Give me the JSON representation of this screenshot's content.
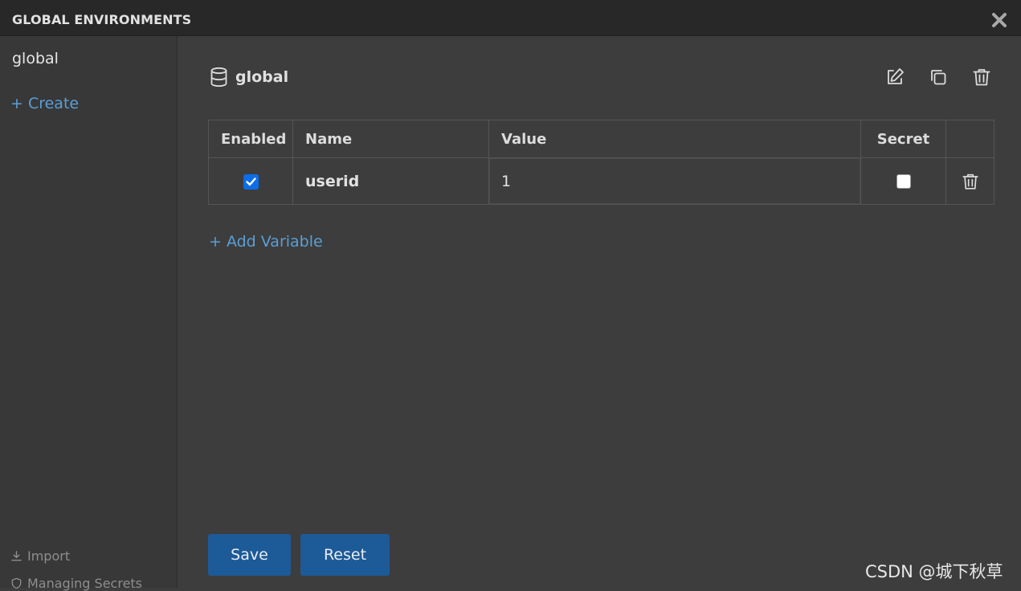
{
  "window": {
    "title": "GLOBAL ENVIRONMENTS"
  },
  "sidebar": {
    "environments": [
      {
        "label": "global"
      }
    ],
    "create_label": "+ Create",
    "import_label": "Import",
    "managing_secrets_label": "Managing Secrets"
  },
  "main": {
    "env_name": "global",
    "table": {
      "headers": {
        "enabled": "Enabled",
        "name": "Name",
        "value": "Value",
        "secret": "Secret"
      },
      "rows": [
        {
          "enabled": true,
          "name": "userid",
          "value": "1",
          "secret": false
        }
      ]
    },
    "add_variable_label": "+ Add Variable",
    "save_label": "Save",
    "reset_label": "Reset"
  },
  "watermark": "CSDN @城下秋草",
  "icons": {
    "close": "close-icon",
    "database": "database-icon",
    "edit": "edit-icon",
    "copy": "copy-icon",
    "trash": "trash-icon",
    "import": "download-icon",
    "shield": "shield-icon"
  },
  "colors": {
    "accent_link": "#5a9fd6",
    "button": "#1d5a98",
    "checkbox": "#0b6ee8"
  }
}
